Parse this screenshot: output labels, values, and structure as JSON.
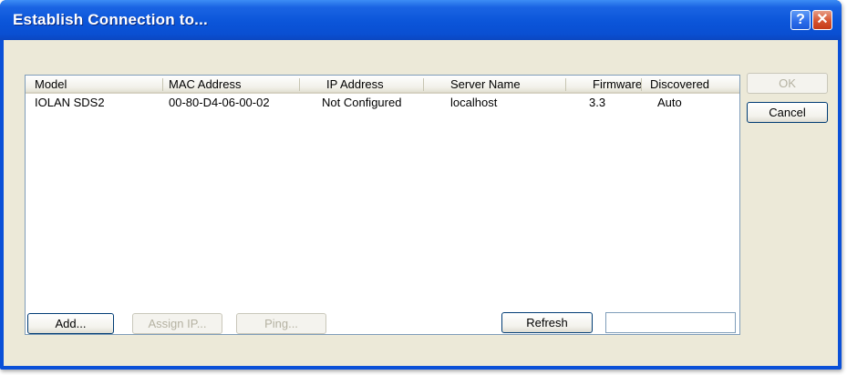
{
  "window": {
    "title": "Establish Connection to...",
    "help_glyph": "?",
    "close_glyph": "✕"
  },
  "list": {
    "columns": [
      "Model",
      "MAC Address",
      "IP Address",
      "Server Name",
      "Firmware",
      "Discovered"
    ],
    "rows": [
      {
        "model": "IOLAN SDS2",
        "mac": "00-80-D4-06-00-02",
        "ip": "Not Configured",
        "server": "localhost",
        "firmware": "3.3",
        "discovered": "Auto"
      }
    ]
  },
  "buttons": {
    "ok": "OK",
    "cancel": "Cancel",
    "add": "Add...",
    "assign_ip": "Assign IP...",
    "ping": "Ping...",
    "refresh": "Refresh"
  },
  "status_field": {
    "value": ""
  },
  "colors": {
    "titlebar": "#0a50d8",
    "dialog_bg": "#ece9d8",
    "list_border": "#7f9db9"
  }
}
